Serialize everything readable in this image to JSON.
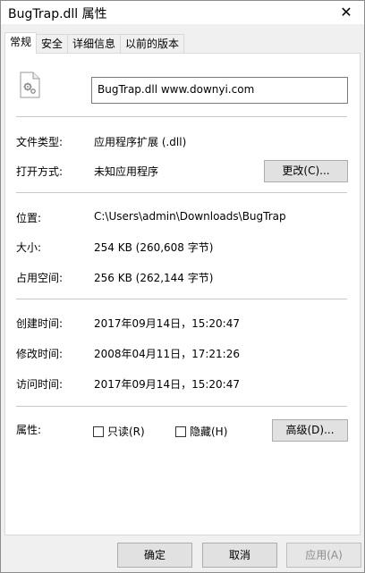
{
  "window": {
    "title": "BugTrap.dll 属性",
    "close_glyph": "✕"
  },
  "tabs": [
    {
      "label": "常规"
    },
    {
      "label": "安全"
    },
    {
      "label": "详细信息"
    },
    {
      "label": "以前的版本"
    }
  ],
  "file": {
    "name": "BugTrap.dll        www.downyi.com"
  },
  "rows": {
    "type_label": "文件类型:",
    "type_value": "应用程序扩展 (.dll)",
    "open_label": "打开方式:",
    "open_value": "未知应用程序",
    "change_button": "更改(C)...",
    "location_label": "位置:",
    "location_value": "C:\\Users\\admin\\Downloads\\BugTrap",
    "size_label": "大小:",
    "size_value": "254 KB (260,608 字节)",
    "disk_label": "占用空间:",
    "disk_value": "256 KB (262,144 字节)",
    "created_label": "创建时间:",
    "created_value": "2017年09月14日，15:20:47",
    "modified_label": "修改时间:",
    "modified_value": "2008年04月11日，17:21:26",
    "accessed_label": "访问时间:",
    "accessed_value": "2017年09月14日，15:20:47",
    "attr_label": "属性:",
    "readonly_label": "只读(R)",
    "hidden_label": "隐藏(H)",
    "advanced_button": "高级(D)..."
  },
  "footer": {
    "ok": "确定",
    "cancel": "取消",
    "apply": "应用(A)"
  }
}
